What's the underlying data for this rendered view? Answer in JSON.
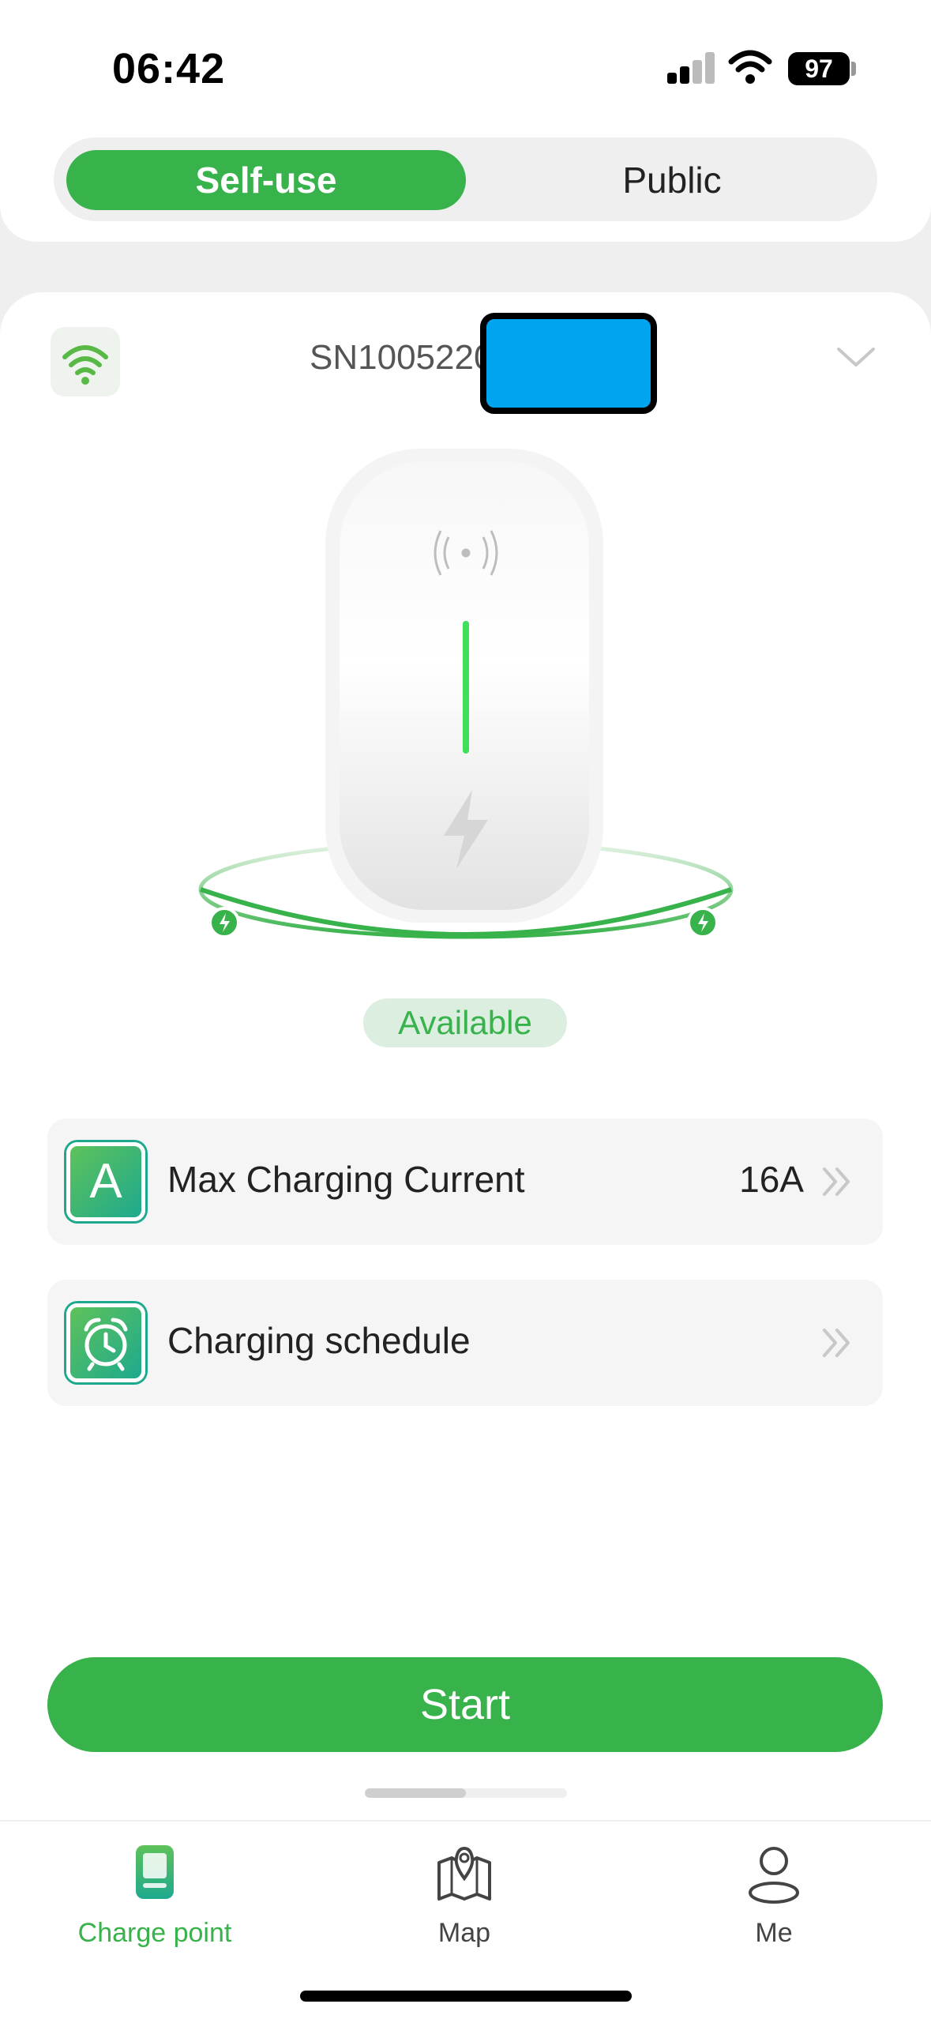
{
  "status_bar": {
    "time": "06:42",
    "battery": "97"
  },
  "segmented": {
    "self_use": "Self-use",
    "public": "Public",
    "selected": "Self-use"
  },
  "device": {
    "serial": "SN1005220",
    "status": "Available",
    "connection_icon": "wifi-icon"
  },
  "settings": [
    {
      "label": "Max Charging Current",
      "value": "16A",
      "icon_letter": "A",
      "icon": "ampere-icon"
    },
    {
      "label": "Charging schedule",
      "value": "",
      "icon": "alarm-clock-icon"
    }
  ],
  "actions": {
    "start": "Start"
  },
  "pager": {
    "current_page": 1,
    "total_pages": 2
  },
  "tabbar": {
    "tabs": [
      {
        "label": "Charge point",
        "icon": "charger-icon",
        "active": true
      },
      {
        "label": "Map",
        "icon": "map-pin-icon",
        "active": false
      },
      {
        "label": "Me",
        "icon": "person-icon",
        "active": false
      }
    ]
  },
  "colors": {
    "accent": "#38b24a",
    "status_bg": "#dbeee0",
    "redaction": "#00a4ef"
  }
}
